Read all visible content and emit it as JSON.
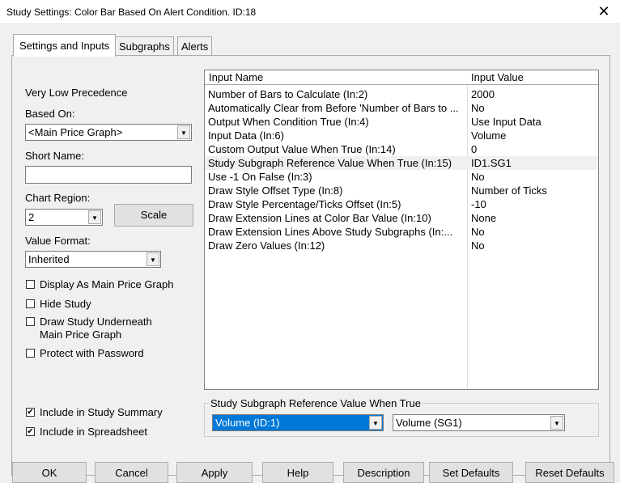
{
  "window": {
    "title": "Study Settings: Color Bar Based On Alert Condition. ID:18",
    "close": "✕"
  },
  "tabs": [
    {
      "label": "Settings and Inputs"
    },
    {
      "label": "Subgraphs"
    },
    {
      "label": "Alerts"
    }
  ],
  "left": {
    "precedence": "Very Low Precedence",
    "based_on_label": "Based On:",
    "based_on_value": "<Main Price Graph>",
    "short_name_label": "Short Name:",
    "short_name_value": "",
    "chart_region_label": "Chart Region:",
    "chart_region_value": "2",
    "scale_button": "Scale",
    "value_format_label": "Value Format:",
    "value_format_value": "Inherited",
    "checkboxes": [
      {
        "label": "Display As Main Price Graph",
        "checked": false
      },
      {
        "label": "Hide Study",
        "checked": false
      },
      {
        "label": "Draw Study Underneath",
        "label2": "Main Price Graph",
        "checked": false
      },
      {
        "label": "Protect with Password",
        "checked": false
      },
      {
        "label": "Include in Study Summary",
        "checked": true
      },
      {
        "label": "Include in Spreadsheet",
        "checked": true
      }
    ]
  },
  "grid": {
    "headers": [
      "Input Name",
      "Input Value"
    ],
    "rows": [
      [
        "Number of Bars to Calculate   (In:2)",
        "2000"
      ],
      [
        "Automatically Clear from Before 'Number of Bars to ...",
        "No"
      ],
      [
        "Output When Condition True   (In:4)",
        "Use Input Data"
      ],
      [
        "Input Data   (In:6)",
        "Volume"
      ],
      [
        "Custom Output Value When True   (In:14)",
        "0"
      ],
      [
        "Study Subgraph Reference Value When True   (In:15)",
        "ID1.SG1"
      ],
      [
        "Use -1 On False   (In:3)",
        "No"
      ],
      [
        "Draw Style Offset Type   (In:8)",
        "Number of Ticks"
      ],
      [
        "Draw Style Percentage/Ticks Offset   (In:5)",
        "-10"
      ],
      [
        "Draw Extension Lines at Color Bar Value   (In:10)",
        "None"
      ],
      [
        "Draw Extension Lines Above Study Subgraphs   (In:...",
        "No"
      ],
      [
        "Draw Zero Values   (In:12)",
        "No"
      ]
    ],
    "selected_row": 5
  },
  "group": {
    "title": "Study Subgraph Reference Value When True",
    "study": "Volume (ID:1)",
    "subgraph": "Volume (SG1)"
  },
  "buttons": [
    "OK",
    "Cancel",
    "Apply",
    "Help",
    "Description",
    "Set Defaults",
    "Reset Defaults"
  ]
}
